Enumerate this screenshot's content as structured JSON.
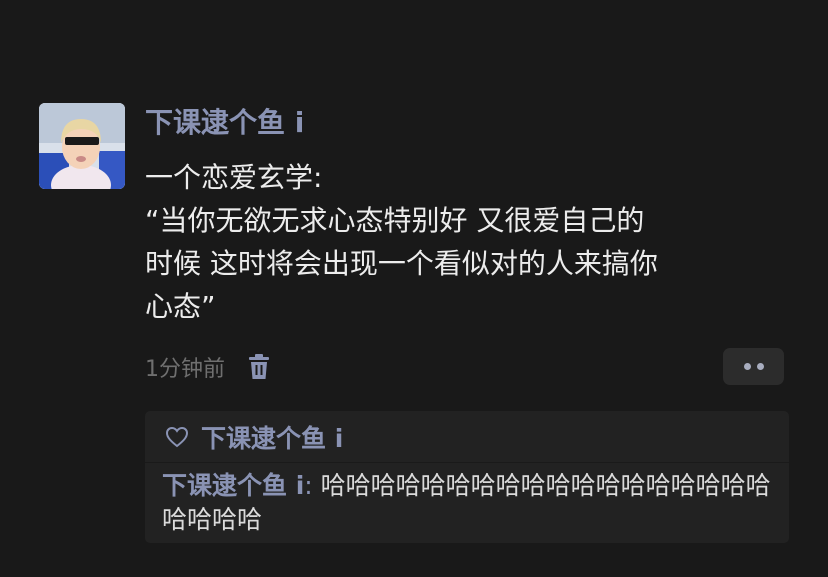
{
  "post": {
    "username": "下课逮个鱼 i",
    "content_lines": [
      "一个恋爱玄学:",
      "“当你无欲无求心态特别好 又很爱自己的",
      "时候 这时将会出现一个看似对的人来搞你",
      "心态”"
    ],
    "time": "1分钟前",
    "icons": {
      "delete": "trash-icon",
      "more": "more-dots-icon",
      "like": "heart-outline-icon"
    }
  },
  "likes": {
    "names": "下课逮个鱼 i"
  },
  "comments": [
    {
      "author": "下课逮个鱼 i",
      "separator": ": ",
      "text": "哈哈哈哈哈哈哈哈哈哈哈哈哈哈哈哈哈哈哈哈哈哈"
    }
  ],
  "colors": {
    "background": "#191919",
    "link_blue": "#8a93b4",
    "text": "#ececec",
    "muted": "#6f6f6f",
    "panel": "#222222"
  }
}
